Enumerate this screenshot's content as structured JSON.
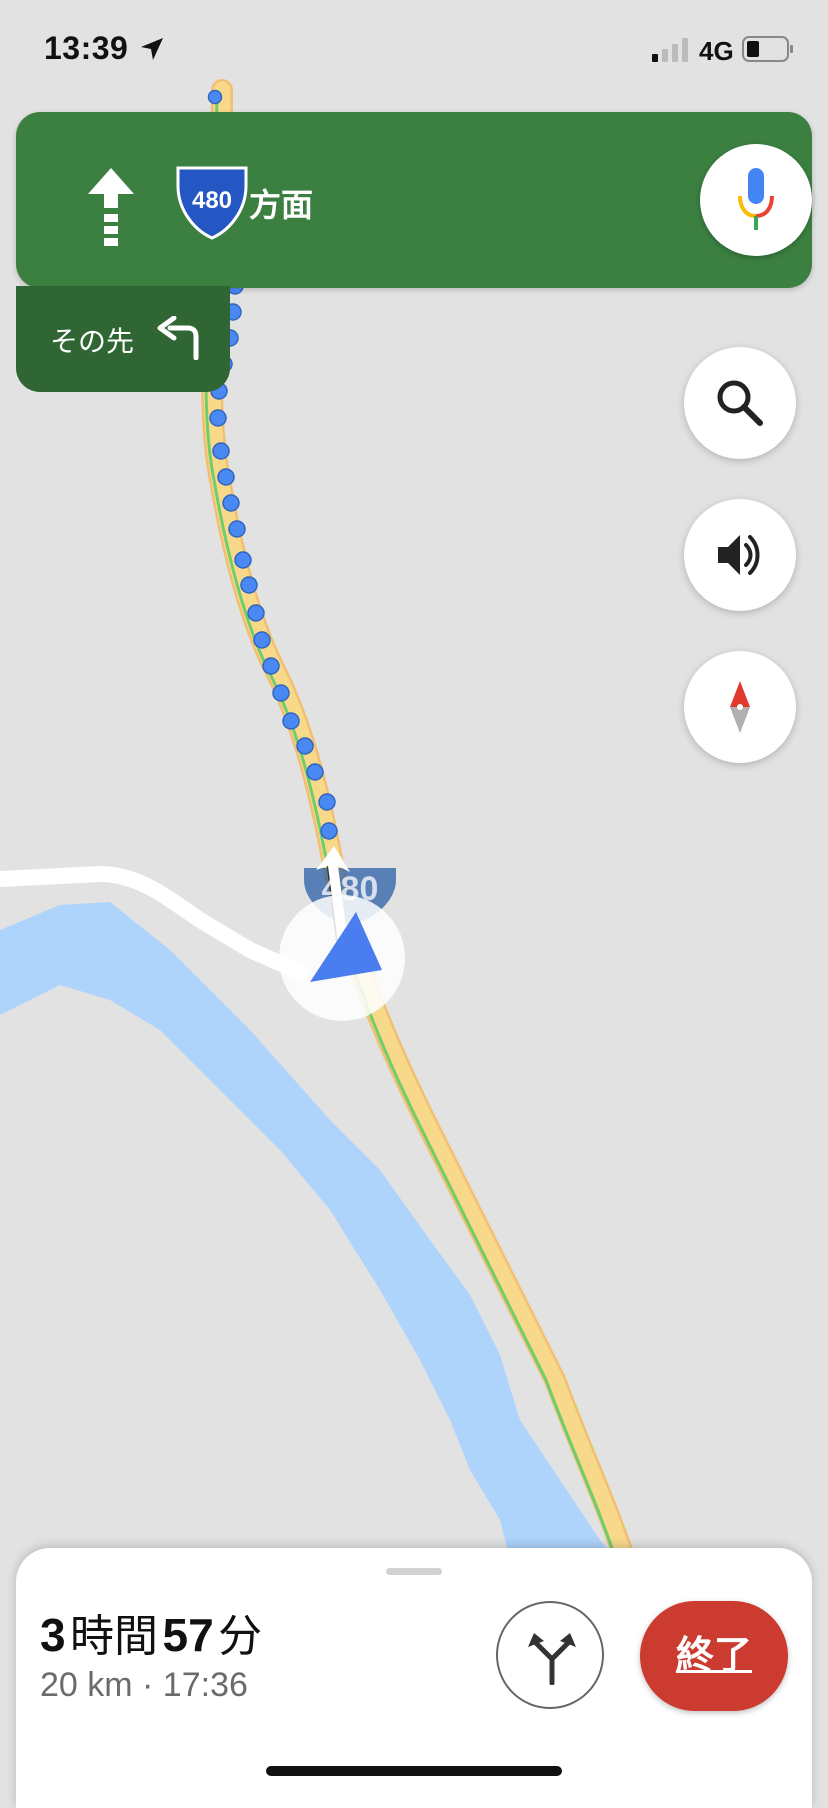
{
  "status_bar": {
    "time": "13:39",
    "network": "4G",
    "location_icon": "location-arrow-icon",
    "signal_icon": "signal-bars-icon",
    "battery_icon": "battery-icon"
  },
  "navigation": {
    "maneuver_icon": "straight-arrow-icon",
    "route_number": "480",
    "direction_text": "方面",
    "voice_search_icon": "mic-icon",
    "then_label": "その先",
    "then_icon": "turn-left-icon"
  },
  "map_controls": {
    "search_icon": "search-icon",
    "sound_icon": "speaker-icon",
    "compass_icon": "compass-icon"
  },
  "map": {
    "road_shield_number": "480",
    "colors": {
      "background": "#e2e2e2",
      "water": "#aed4fb",
      "highway": "#f8d98a",
      "traffic": "#6fcd6e",
      "route_dots": "#4a89f3"
    }
  },
  "trip": {
    "hours": "3",
    "hours_unit": "時間",
    "minutes": "57",
    "minutes_unit": "分",
    "distance_eta": "20 km · 17:36",
    "alternate_routes_icon": "alternate-routes-icon",
    "end_label": "終了"
  },
  "colors": {
    "banner_green": "#3b8041",
    "then_green": "#2f6634",
    "end_red": "#cb3b30"
  }
}
